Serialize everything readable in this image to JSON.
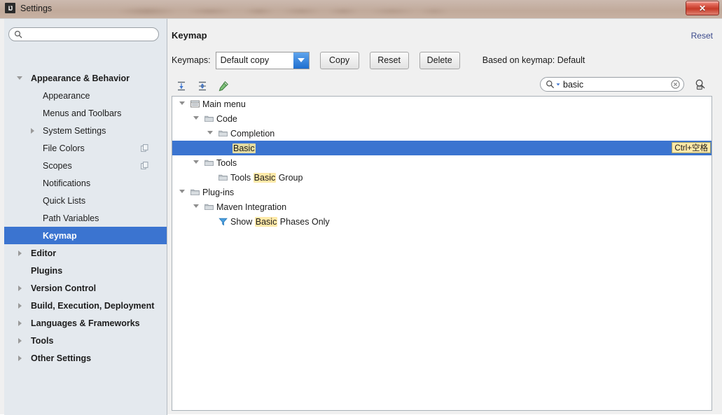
{
  "window": {
    "title": "Settings",
    "app_icon": "intellij-idea-icon",
    "close_label": "✕"
  },
  "sidebar": {
    "search_placeholder": "",
    "search_value": "",
    "search_icon": "search-icon",
    "items": [
      {
        "label": "Appearance & Behavior",
        "level": 0,
        "bold": true,
        "arrow": "down",
        "selected": false,
        "badge": false
      },
      {
        "label": "Appearance",
        "level": 1,
        "bold": false,
        "arrow": "none",
        "selected": false,
        "badge": false
      },
      {
        "label": "Menus and Toolbars",
        "level": 1,
        "bold": false,
        "arrow": "none",
        "selected": false,
        "badge": false
      },
      {
        "label": "System Settings",
        "level": 1,
        "bold": false,
        "arrow": "right",
        "selected": false,
        "badge": false
      },
      {
        "label": "File Colors",
        "level": 1,
        "bold": false,
        "arrow": "none",
        "selected": false,
        "badge": true
      },
      {
        "label": "Scopes",
        "level": 1,
        "bold": false,
        "arrow": "none",
        "selected": false,
        "badge": true
      },
      {
        "label": "Notifications",
        "level": 1,
        "bold": false,
        "arrow": "none",
        "selected": false,
        "badge": false
      },
      {
        "label": "Quick Lists",
        "level": 1,
        "bold": false,
        "arrow": "none",
        "selected": false,
        "badge": false
      },
      {
        "label": "Path Variables",
        "level": 1,
        "bold": false,
        "arrow": "none",
        "selected": false,
        "badge": false
      },
      {
        "label": "Keymap",
        "level": 1,
        "bold": true,
        "arrow": "none",
        "selected": true,
        "badge": false
      },
      {
        "label": "Editor",
        "level": 0,
        "bold": true,
        "arrow": "right",
        "selected": false,
        "badge": false
      },
      {
        "label": "Plugins",
        "level": 0,
        "bold": true,
        "arrow": "none",
        "selected": false,
        "badge": false
      },
      {
        "label": "Version Control",
        "level": 0,
        "bold": true,
        "arrow": "right",
        "selected": false,
        "badge": false
      },
      {
        "label": "Build, Execution, Deployment",
        "level": 0,
        "bold": true,
        "arrow": "right",
        "selected": false,
        "badge": false
      },
      {
        "label": "Languages & Frameworks",
        "level": 0,
        "bold": true,
        "arrow": "right",
        "selected": false,
        "badge": false
      },
      {
        "label": "Tools",
        "level": 0,
        "bold": true,
        "arrow": "right",
        "selected": false,
        "badge": false
      },
      {
        "label": "Other Settings",
        "level": 0,
        "bold": true,
        "arrow": "right",
        "selected": false,
        "badge": false
      }
    ]
  },
  "content": {
    "title": "Keymap",
    "reset_link": "Reset",
    "keymaps_label": "Keymaps:",
    "keymap_selected": "Default copy",
    "buttons": {
      "copy": "Copy",
      "reset": "Reset",
      "delete": "Delete"
    },
    "based_on": "Based on keymap: Default",
    "toolbar": [
      {
        "name": "expand-all-icon",
        "title": "Expand All"
      },
      {
        "name": "collapse-all-icon",
        "title": "Collapse All"
      },
      {
        "name": "edit-shortcut-icon",
        "title": "Edit Shortcut"
      }
    ],
    "search": {
      "value": "basic",
      "placeholder": "",
      "lead_icon": "search-dropdown-icon",
      "clear_icon": "clear-icon"
    },
    "find_shortcut_icon": "find-by-shortcut-icon"
  },
  "tree": {
    "rows": [
      {
        "indent": 0,
        "arrow": "down",
        "icon": "main-menu-icon",
        "pre": "Main menu",
        "hl": "",
        "post": "",
        "selected": false,
        "shortcut": ""
      },
      {
        "indent": 1,
        "arrow": "down",
        "icon": "folder-icon",
        "pre": "Code",
        "hl": "",
        "post": "",
        "selected": false,
        "shortcut": ""
      },
      {
        "indent": 2,
        "arrow": "down",
        "icon": "folder-icon",
        "pre": "Completion",
        "hl": "",
        "post": "",
        "selected": false,
        "shortcut": ""
      },
      {
        "indent": 3,
        "arrow": "none",
        "icon": "none",
        "pre": "",
        "hl": "Basic",
        "post": "",
        "selected": true,
        "shortcut": "Ctrl+空格"
      },
      {
        "indent": 1,
        "arrow": "down",
        "icon": "folder-icon",
        "pre": "Tools",
        "hl": "",
        "post": "",
        "selected": false,
        "shortcut": ""
      },
      {
        "indent": 2,
        "arrow": "none",
        "icon": "folder-icon",
        "pre": "Tools ",
        "hl": "Basic",
        "post": " Group",
        "selected": false,
        "shortcut": ""
      },
      {
        "indent": 0,
        "arrow": "down",
        "icon": "folder-icon",
        "pre": "Plug-ins",
        "hl": "",
        "post": "",
        "selected": false,
        "shortcut": ""
      },
      {
        "indent": 1,
        "arrow": "down",
        "icon": "folder-icon",
        "pre": "Maven Integration",
        "hl": "",
        "post": "",
        "selected": false,
        "shortcut": ""
      },
      {
        "indent": 2,
        "arrow": "none",
        "icon": "filter-icon",
        "pre": "Show ",
        "hl": "Basic",
        "post": " Phases Only",
        "selected": false,
        "shortcut": ""
      }
    ]
  },
  "colors": {
    "selection_blue": "#3b74d0",
    "highlight_yellow": "#ffe9a8",
    "link_blue": "#3b4a8c",
    "sidebar_bg": "#e4e9ee",
    "close_red": "#c63a28"
  }
}
